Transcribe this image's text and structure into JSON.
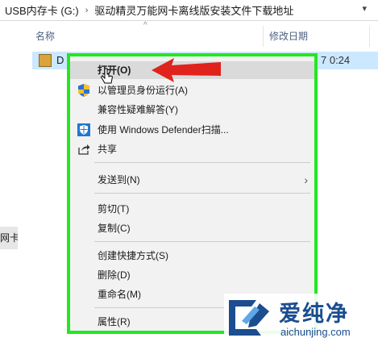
{
  "address_bar": {
    "crumbs": [
      "USB内存卡 (G:)",
      "驱动精灵万能网卡离线版安装文件下载地址"
    ]
  },
  "columns": {
    "name": "名称",
    "date": "修改日期"
  },
  "file": {
    "name": "D",
    "date": "7 0:24"
  },
  "sidebar": {
    "fragment": "网卡离"
  },
  "context_menu": {
    "items": [
      {
        "label": "打开(O)",
        "bold": true,
        "highlighted": true
      },
      {
        "label": "以管理员身份运行(A)",
        "icon": "uac-shield-icon"
      },
      {
        "label": "兼容性疑难解答(Y)"
      },
      {
        "label": "使用 Windows Defender扫描...",
        "icon": "windows-defender-icon"
      },
      {
        "label": "共享",
        "icon": "share-icon"
      },
      {
        "label": "发送到(N)",
        "submenu": true
      },
      {
        "label": "剪切(T)"
      },
      {
        "label": "复制(C)"
      },
      {
        "label": "创建快捷方式(S)"
      },
      {
        "label": "删除(D)"
      },
      {
        "label": "重命名(M)"
      },
      {
        "label": "属性(R)"
      }
    ]
  },
  "watermark": {
    "title": "爱纯净",
    "url": "aichunjing.com"
  },
  "colors": {
    "highlight_border": "#22e81f",
    "arrow": "#e0231c",
    "selection": "#cce8ff",
    "brand": "#1b4d8f"
  }
}
